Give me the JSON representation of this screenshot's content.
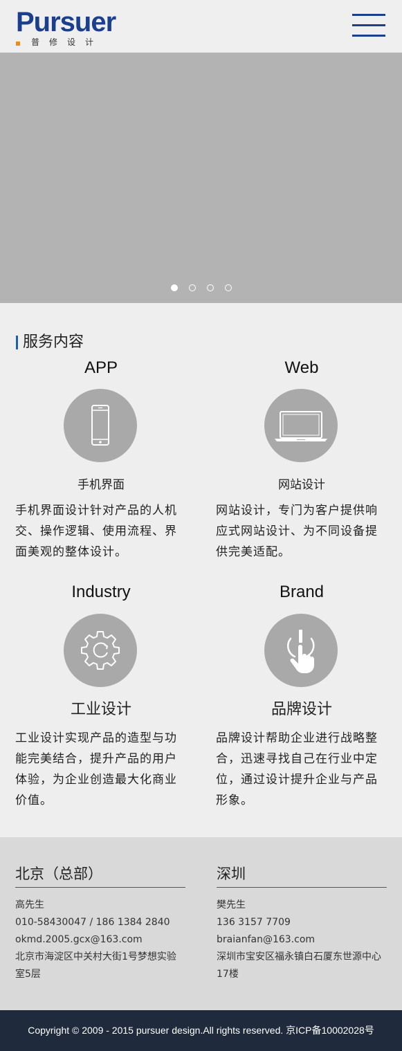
{
  "header": {
    "logo_text": "Pursuer",
    "logo_subtitle": "普修设计",
    "menu_icon": "hamburger-menu-icon",
    "brand_color": "#1b3f8c",
    "accent_color": "#f08a1c"
  },
  "carousel": {
    "slide_count": 4,
    "active_index": 0
  },
  "services": {
    "title": "服务内容",
    "items": [
      {
        "name": "APP",
        "icon": "smartphone-icon",
        "subtitle": "手机界面",
        "description": "手机界面设计针对产品的人机交、操作逻辑、使用流程、界面美观的整体设计。"
      },
      {
        "name": "Web",
        "icon": "laptop-icon",
        "subtitle": "网站设计",
        "description": "网站设计，专门为客户提供响应式网站设计、为不同设备提供完美适配。"
      },
      {
        "name": "Industry",
        "icon": "gear-icon",
        "subtitle": "工业设计",
        "description": "工业设计实现产品的造型与功能完美结合，提升产品的用户体验，为企业创造最大化商业价值。"
      },
      {
        "name": "Brand",
        "icon": "touch-hand-icon",
        "subtitle": "品牌设计",
        "description": "品牌设计帮助企业进行战略整合，迅速寻找自己在行业中定位，通过设计提升企业与产品形象。"
      }
    ]
  },
  "offices": [
    {
      "city": "北京（总部）",
      "contact": "高先生",
      "phone": "010-58430047 / 186 1384 2840",
      "email": "okmd.2005.gcx@163.com",
      "address": "北京市海淀区中关村大街1号梦想实验室5层"
    },
    {
      "city": "深圳",
      "contact": "樊先生",
      "phone": "136 3157 7709",
      "email": "braianfan@163.com",
      "address": "深圳市宝安区福永镇白石厦东世源中心17楼"
    }
  ],
  "footer": {
    "copyright": "Copyright © 2009 - 2015 pursuer design.All rights reserved. 京ICP备10002028号"
  }
}
